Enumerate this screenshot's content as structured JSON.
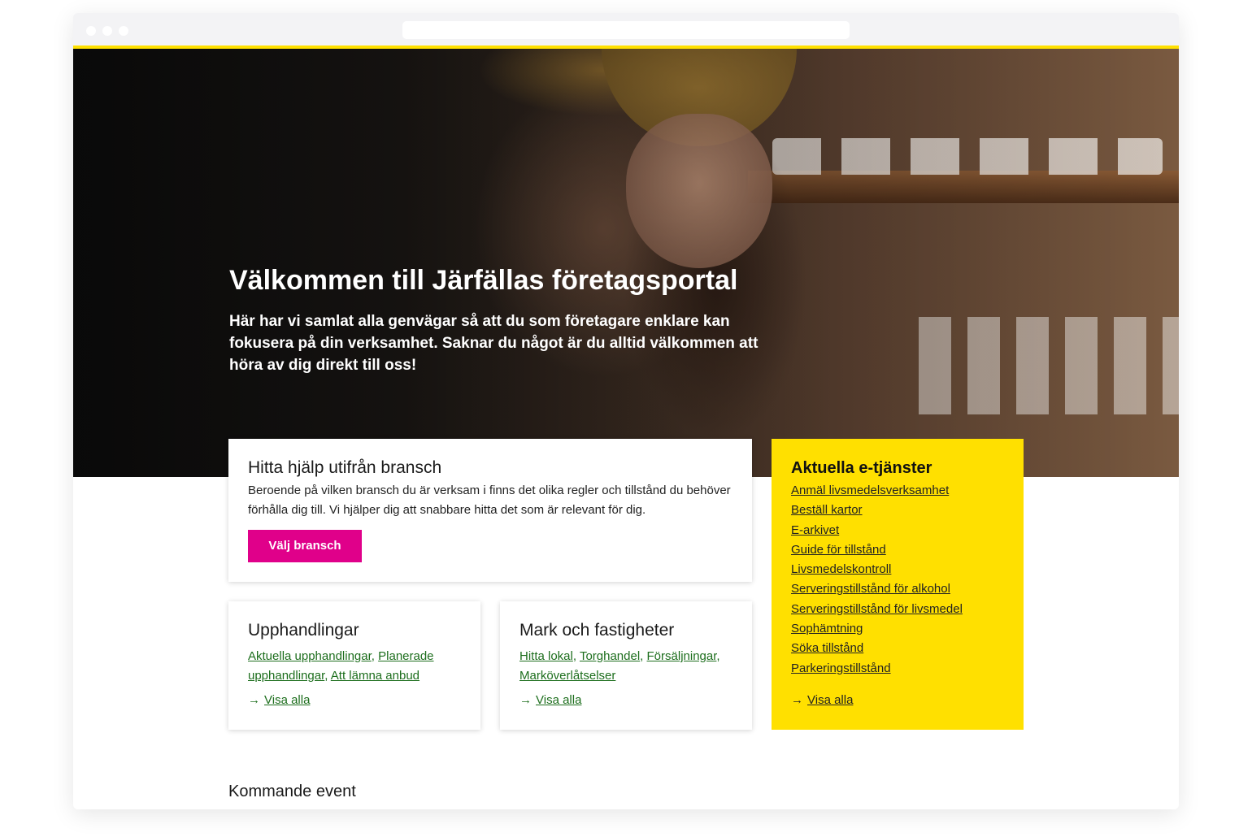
{
  "hero": {
    "title": "Välkommen till Järfällas företagsportal",
    "text": "Här har vi samlat alla genvägar så att du som företagare enklare kan fokusera på din verksamhet. Saknar du något är du alltid välkommen att höra av dig direkt till oss!"
  },
  "bransch": {
    "title": "Hitta hjälp utifrån bransch",
    "text": "Beroende på vilken bransch du är verksam i finns det olika regler och tillstånd du behöver förhålla dig till. Vi hjälper dig att snabbare hitta det som är relevant för dig.",
    "button": "Välj bransch"
  },
  "upphandlingar": {
    "title": "Upphandlingar",
    "links": [
      "Aktuella upphandlingar",
      "Planerade upphandlingar",
      "Att lämna anbud"
    ],
    "visa_alla": "Visa alla"
  },
  "mark": {
    "title": "Mark och fastigheter",
    "links": [
      "Hitta lokal",
      "Torghandel",
      "Försäljningar",
      "Marköverlåtselser"
    ],
    "visa_alla": "Visa alla"
  },
  "etjanster": {
    "title": "Aktuella e-tjänster",
    "items": [
      "Anmäl livsmedelsverksamhet ",
      "Beställ kartor",
      "E-arkivet",
      "Guide för tillstånd",
      "Livsmedelskontroll",
      "Serveringstillstånd för alkohol",
      "Serveringstillstånd för livsmedel",
      "Sophämtning",
      "Söka tillstånd",
      "Parkeringstillstånd"
    ],
    "visa_alla": "Visa alla"
  },
  "events": {
    "title": "Kommande event"
  },
  "icons": {
    "arrow": "arrow-right-icon"
  },
  "colors": {
    "accent_yellow": "#ffe000",
    "button_magenta": "#e0008a",
    "link_green": "#1d6e1d"
  }
}
